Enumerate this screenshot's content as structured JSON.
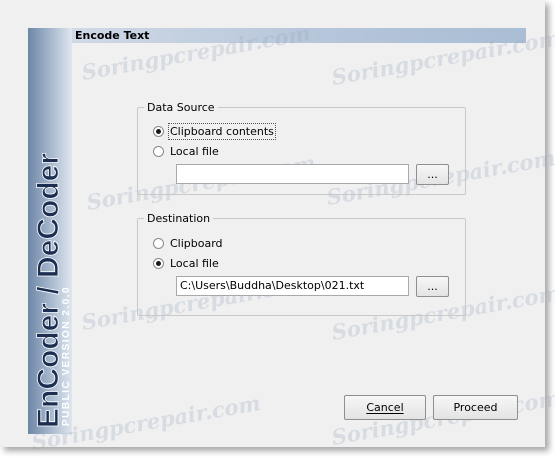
{
  "dialog": {
    "title": "Encode Text"
  },
  "branding": {
    "product_name": "EnCoder / DeCoder",
    "version": "PUBLIC VERSION 2.0.0"
  },
  "data_source": {
    "legend": "Data Source",
    "option_clipboard": "Clipboard contents",
    "option_file": "Local file",
    "selected": "Clipboard contents",
    "file_value": "",
    "browse_label": "..."
  },
  "destination": {
    "legend": "Destination",
    "option_clipboard": "Clipboard",
    "option_file": "Local file",
    "selected": "Local file",
    "file_value": "C:\\Users\\Buddha\\Desktop\\021.txt",
    "browse_label": "..."
  },
  "buttons": {
    "cancel_label": "Cancel",
    "proceed_label": "Proceed"
  },
  "watermark": {
    "text": "Soringpcrepair.com"
  },
  "colors": {
    "titlebar": "#b6c6da",
    "sidebar_dark": "#6e86a6",
    "window_bg": "#f0f0f0"
  }
}
